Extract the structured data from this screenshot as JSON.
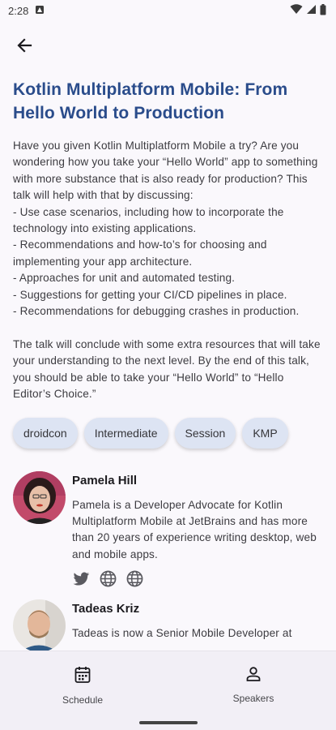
{
  "status_bar": {
    "time": "2:28"
  },
  "session": {
    "title": "Kotlin Multiplatform Mobile: From Hello World to Production",
    "description": "Have you given Kotlin Multiplatform Mobile a try? Are you wondering how you take your “Hello World” app to something with more substance that is also ready for production? This talk will help with that by discussing:\n- Use case scenarios, including how to incorporate the technology into existing applications.\n- Recommendations and how-to’s for choosing and implementing your app architecture.\n- Approaches for unit and automated testing.\n- Suggestions for getting your CI/CD pipelines in place.\n- Recommendations for debugging crashes in production.\n\nThe talk will conclude with some extra resources that will take your understanding to the next level. By the end of this talk, you should be able to take your “Hello World” to “Hello Editor’s Choice.”",
    "tags": [
      "droidcon",
      "Intermediate",
      "Session",
      "KMP"
    ]
  },
  "speakers": [
    {
      "name": "Pamela Hill",
      "bio": "Pamela is a Developer Advocate for Kotlin Multiplatform Mobile at JetBrains and has more than 20 years of experience writing desktop, web and mobile apps.",
      "social_icons": [
        "twitter-icon",
        "globe-icon",
        "globe-icon"
      ]
    },
    {
      "name": "Tadeas Kriz",
      "bio": "Tadeas is now a Senior Mobile Developer at"
    }
  ],
  "bottom_nav": {
    "schedule_label": "Schedule",
    "speakers_label": "Speakers"
  },
  "colors": {
    "title": "#2a4c8b",
    "chip_background": "#dde4f3",
    "nav_background": "#f2eff6"
  }
}
